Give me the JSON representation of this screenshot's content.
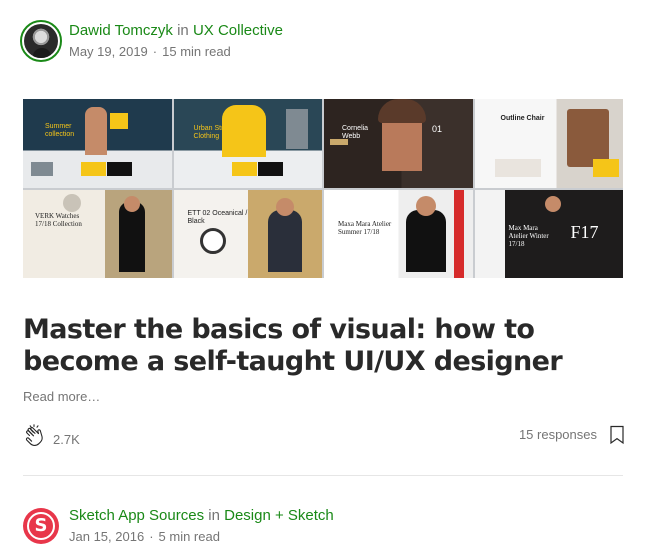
{
  "post1": {
    "author": "Dawid Tomczyk",
    "in_word": "in",
    "publication": "UX Collective",
    "date": "May 19, 2019",
    "read_time": "15 min read",
    "hero_texts": {
      "t1": "Summer collection",
      "t2": "Urban Street Clothing",
      "t3": "Cornelia Webb",
      "t3_num": "01",
      "t4": "Outline Chair",
      "t5": "VERK Watches 17/18 Collection",
      "t6": "ETT 02 Oceanical / Black",
      "t7": "Maxa Mara Atelier Summer 17/18",
      "t8_title": "Max Mara Atelier Winter 17/18",
      "t8_big": "F17"
    },
    "title": "Master the basics of visual: how to become a self-taught UI/UX designer",
    "read_more": "Read more…",
    "claps": "2.7K",
    "responses": "15 responses"
  },
  "post2": {
    "avatar_letter": "S",
    "author": "Sketch App Sources",
    "in_word": "in",
    "publication": "Design + Sketch",
    "date": "Jan 15, 2016",
    "read_time": "5 min read"
  },
  "colors": {
    "accent_green": "#1a8917",
    "meta_gray": "#757575",
    "sketch_red": "#e8364a"
  },
  "icons": [
    "clap-icon",
    "bookmark-icon"
  ]
}
